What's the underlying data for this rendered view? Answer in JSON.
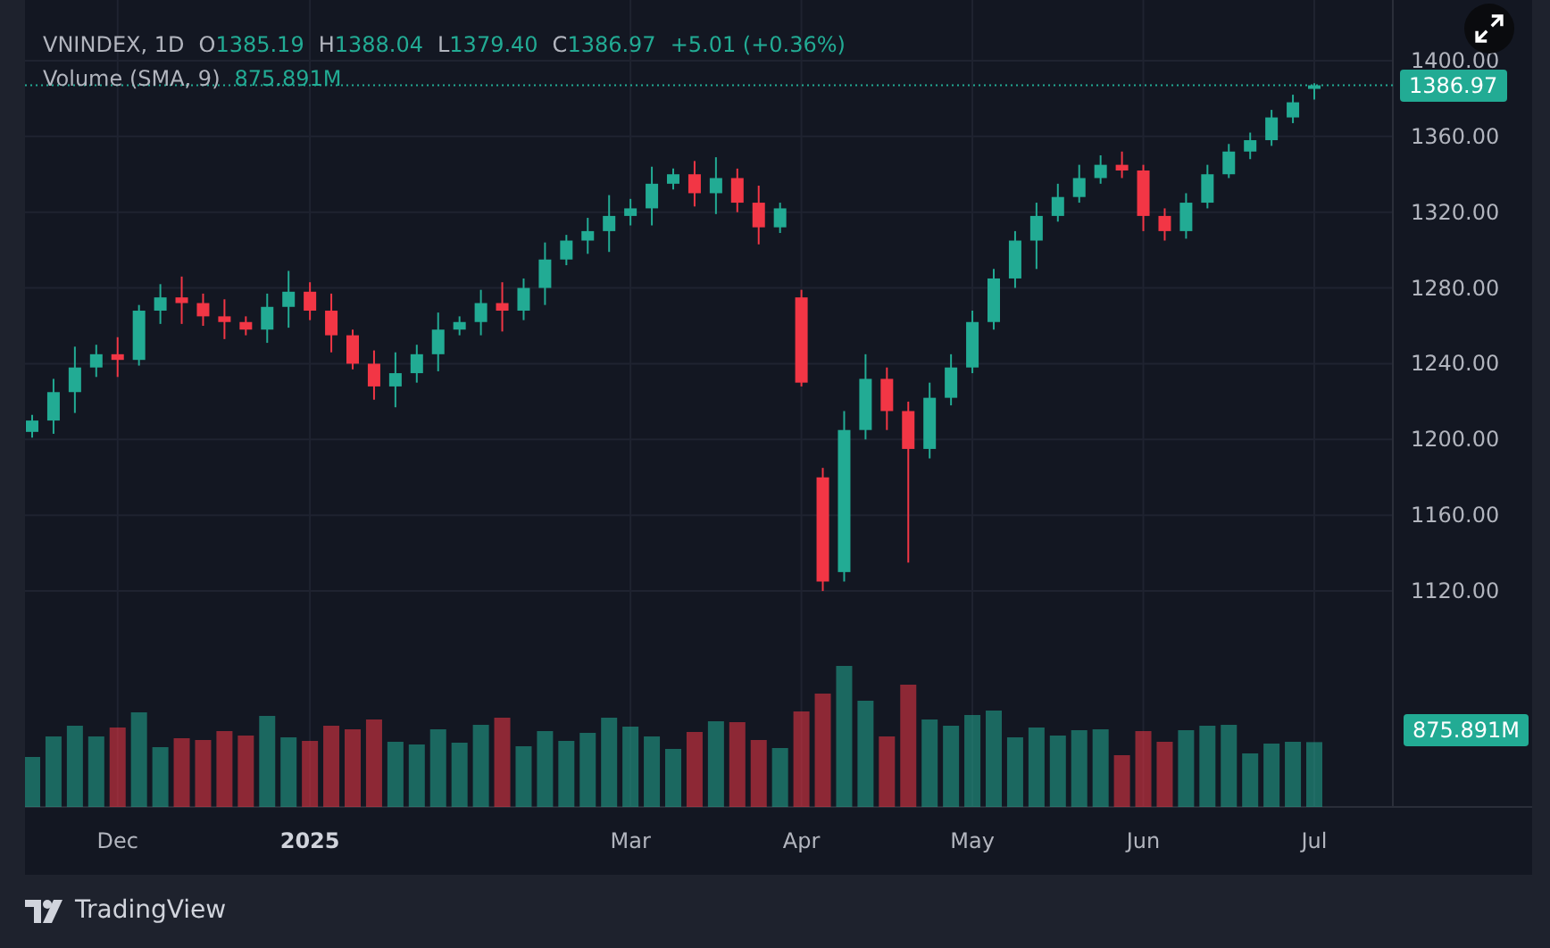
{
  "legend": {
    "symbol": "VNINDEX, 1D",
    "ohlc": [
      {
        "key": "O",
        "value": "1385.19"
      },
      {
        "key": "H",
        "value": "1388.04"
      },
      {
        "key": "L",
        "value": "1379.40"
      },
      {
        "key": "C",
        "value": "1386.97"
      }
    ],
    "change": "+5.01 (+0.36%)",
    "volume_label": "Volume (SMA, 9)",
    "volume_value": "875.891M"
  },
  "chart_data": {
    "type": "candlestick",
    "grid": true,
    "ylim": [
      1006,
      1432
    ],
    "yticks": [
      {
        "value": 1400,
        "label": "1400.00"
      },
      {
        "value": 1360,
        "label": "1360.00"
      },
      {
        "value": 1320,
        "label": "1320.00"
      },
      {
        "value": 1280,
        "label": "1280.00"
      },
      {
        "value": 1240,
        "label": "1240.00"
      },
      {
        "value": 1200,
        "label": "1200.00"
      },
      {
        "value": 1160,
        "label": "1160.00"
      },
      {
        "value": 1120,
        "label": "1120.00"
      }
    ],
    "categories": [
      null,
      null,
      null,
      null,
      "Dec",
      null,
      null,
      null,
      null,
      null,
      null,
      null,
      null,
      "2025",
      null,
      null,
      null,
      null,
      null,
      null,
      null,
      null,
      null,
      null,
      null,
      null,
      null,
      null,
      "Mar",
      null,
      null,
      null,
      null,
      null,
      null,
      null,
      "Apr",
      null,
      null,
      null,
      null,
      null,
      null,
      null,
      "May",
      null,
      null,
      null,
      null,
      null,
      null,
      null,
      "Jun",
      null,
      null,
      null,
      null,
      null,
      null,
      null,
      "Jul"
    ],
    "ohlc": [
      [
        1204,
        1213,
        1201,
        1210
      ],
      [
        1210,
        1232,
        1203,
        1225
      ],
      [
        1225,
        1249,
        1214,
        1238
      ],
      [
        1238,
        1250,
        1233,
        1245
      ],
      [
        1245,
        1254,
        1233,
        1242
      ],
      [
        1242,
        1271,
        1239,
        1268
      ],
      [
        1268,
        1282,
        1261,
        1275
      ],
      [
        1275,
        1286,
        1261,
        1272
      ],
      [
        1272,
        1277,
        1260,
        1265
      ],
      [
        1265,
        1274,
        1253,
        1262
      ],
      [
        1262,
        1265,
        1255,
        1258
      ],
      [
        1258,
        1277,
        1251,
        1270
      ],
      [
        1270,
        1289,
        1259,
        1278
      ],
      [
        1278,
        1283,
        1263,
        1268
      ],
      [
        1268,
        1277,
        1246,
        1255
      ],
      [
        1255,
        1258,
        1237,
        1240
      ],
      [
        1240,
        1247,
        1221,
        1228
      ],
      [
        1228,
        1246,
        1217,
        1235
      ],
      [
        1235,
        1250,
        1230,
        1245
      ],
      [
        1245,
        1267,
        1236,
        1258
      ],
      [
        1258,
        1265,
        1255,
        1262
      ],
      [
        1262,
        1279,
        1255,
        1272
      ],
      [
        1272,
        1283,
        1257,
        1268
      ],
      [
        1268,
        1285,
        1263,
        1280
      ],
      [
        1280,
        1304,
        1271,
        1295
      ],
      [
        1295,
        1308,
        1292,
        1305
      ],
      [
        1305,
        1317,
        1298,
        1310
      ],
      [
        1310,
        1329,
        1299,
        1318
      ],
      [
        1318,
        1327,
        1313,
        1322
      ],
      [
        1322,
        1344,
        1313,
        1335
      ],
      [
        1335,
        1343,
        1332,
        1340
      ],
      [
        1340,
        1347,
        1323,
        1330
      ],
      [
        1330,
        1349,
        1319,
        1338
      ],
      [
        1338,
        1343,
        1320,
        1325
      ],
      [
        1325,
        1334,
        1303,
        1312
      ],
      [
        1312,
        1325,
        1309,
        1322
      ],
      [
        1275,
        1279,
        1228,
        1230
      ],
      [
        1180,
        1185,
        1120,
        1125
      ],
      [
        1130,
        1215,
        1125,
        1205
      ],
      [
        1205,
        1245,
        1200,
        1232
      ],
      [
        1232,
        1238,
        1205,
        1215
      ],
      [
        1215,
        1220,
        1135,
        1195
      ],
      [
        1195,
        1230,
        1190,
        1222
      ],
      [
        1222,
        1245,
        1218,
        1238
      ],
      [
        1238,
        1268,
        1235,
        1262
      ],
      [
        1262,
        1290,
        1258,
        1285
      ],
      [
        1285,
        1310,
        1280,
        1305
      ],
      [
        1305,
        1325,
        1290,
        1318
      ],
      [
        1318,
        1335,
        1315,
        1328
      ],
      [
        1328,
        1345,
        1325,
        1338
      ],
      [
        1338,
        1350,
        1335,
        1345
      ],
      [
        1345,
        1352,
        1338,
        1342
      ],
      [
        1342,
        1345,
        1310,
        1318
      ],
      [
        1318,
        1322,
        1305,
        1310
      ],
      [
        1310,
        1330,
        1306,
        1325
      ],
      [
        1325,
        1345,
        1322,
        1340
      ],
      [
        1340,
        1356,
        1338,
        1352
      ],
      [
        1352,
        1362,
        1348,
        1358
      ],
      [
        1358,
        1374,
        1355,
        1370
      ],
      [
        1370,
        1382,
        1367,
        1378
      ],
      [
        1385.19,
        1388.04,
        1379.4,
        1386.97
      ]
    ]
  },
  "last_price": "1386.97",
  "volume_badge": "875.891M",
  "expand_button": {
    "on": true
  },
  "brand": "TradingView"
}
